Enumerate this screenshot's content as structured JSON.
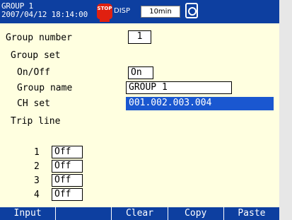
{
  "status": {
    "group_title": "GROUP 1",
    "datetime": "2007/04/12 18:14:00",
    "stop_icon_text": "STOP",
    "disp_label": "DISP",
    "disp_interval": "10min",
    "colors": {
      "bar": "#0d3fa0",
      "stop": "#e02010"
    },
    "icons": [
      "stop-icon",
      "memory-media-icon"
    ]
  },
  "form": {
    "group_number_label": "Group number",
    "group_number_value": "1",
    "group_set_label": "Group set",
    "onoff_label": "On/Off",
    "onoff_value": "On",
    "group_name_label": "Group name",
    "group_name_value": "GROUP 1",
    "ch_set_label": "CH set",
    "ch_set_value": "001.002.003.004",
    "trip_line_label": "Trip line",
    "trip_lines": [
      {
        "num": "1",
        "value": "Off"
      },
      {
        "num": "2",
        "value": "Off"
      },
      {
        "num": "3",
        "value": "Off"
      },
      {
        "num": "4",
        "value": "Off"
      }
    ],
    "colors": {
      "background": "#ffffe0",
      "selected": "#1a57d0"
    }
  },
  "softkeys": [
    "Input",
    "",
    "Clear",
    "Copy",
    "Paste"
  ]
}
